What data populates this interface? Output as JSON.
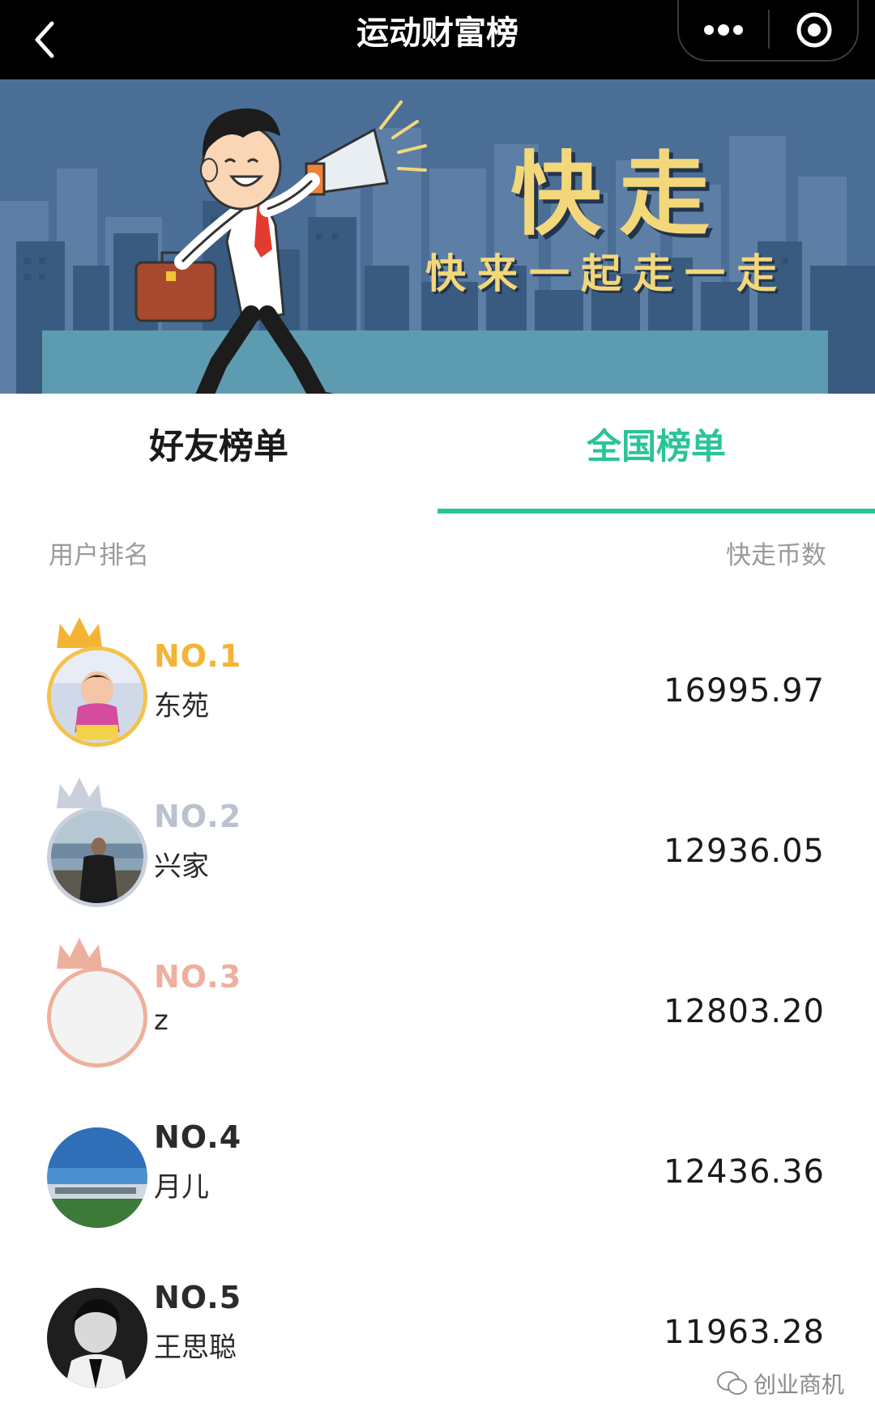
{
  "navbar": {
    "title": "运动财富榜",
    "back_icon": "chevron-left-icon",
    "more_icon": "more-dots-icon",
    "close_icon": "record-close-icon"
  },
  "banner": {
    "title": "快走",
    "subtitle": "快来一起走一走"
  },
  "tabs": [
    {
      "label": "好友榜单",
      "active": false
    },
    {
      "label": "全国榜单",
      "active": true
    }
  ],
  "list_header": {
    "left": "用户排名",
    "right": "快走币数"
  },
  "ranking": [
    {
      "rank": "NO.1",
      "name": "东苑",
      "score": "16995.97",
      "color": "#f5b335"
    },
    {
      "rank": "NO.2",
      "name": "兴家",
      "score": "12936.05",
      "color": "#b9c2d0"
    },
    {
      "rank": "NO.3",
      "name": "z",
      "score": "12803.20",
      "color": "#eeb09e"
    },
    {
      "rank": "NO.4",
      "name": "月儿",
      "score": "12436.36",
      "color": "#2b2b2b"
    },
    {
      "rank": "NO.5",
      "name": "王思聪",
      "score": "11963.28",
      "color": "#2b2b2b"
    }
  ],
  "watermark": {
    "text": "创业商机",
    "icon": "wechat-icon"
  },
  "colors": {
    "accent": "#2bc39a",
    "gold": "#f5b335",
    "silver": "#b9c2d0",
    "bronze": "#eeb09e",
    "banner_bg": "#4b6e97",
    "banner_text": "#f3d77b"
  }
}
